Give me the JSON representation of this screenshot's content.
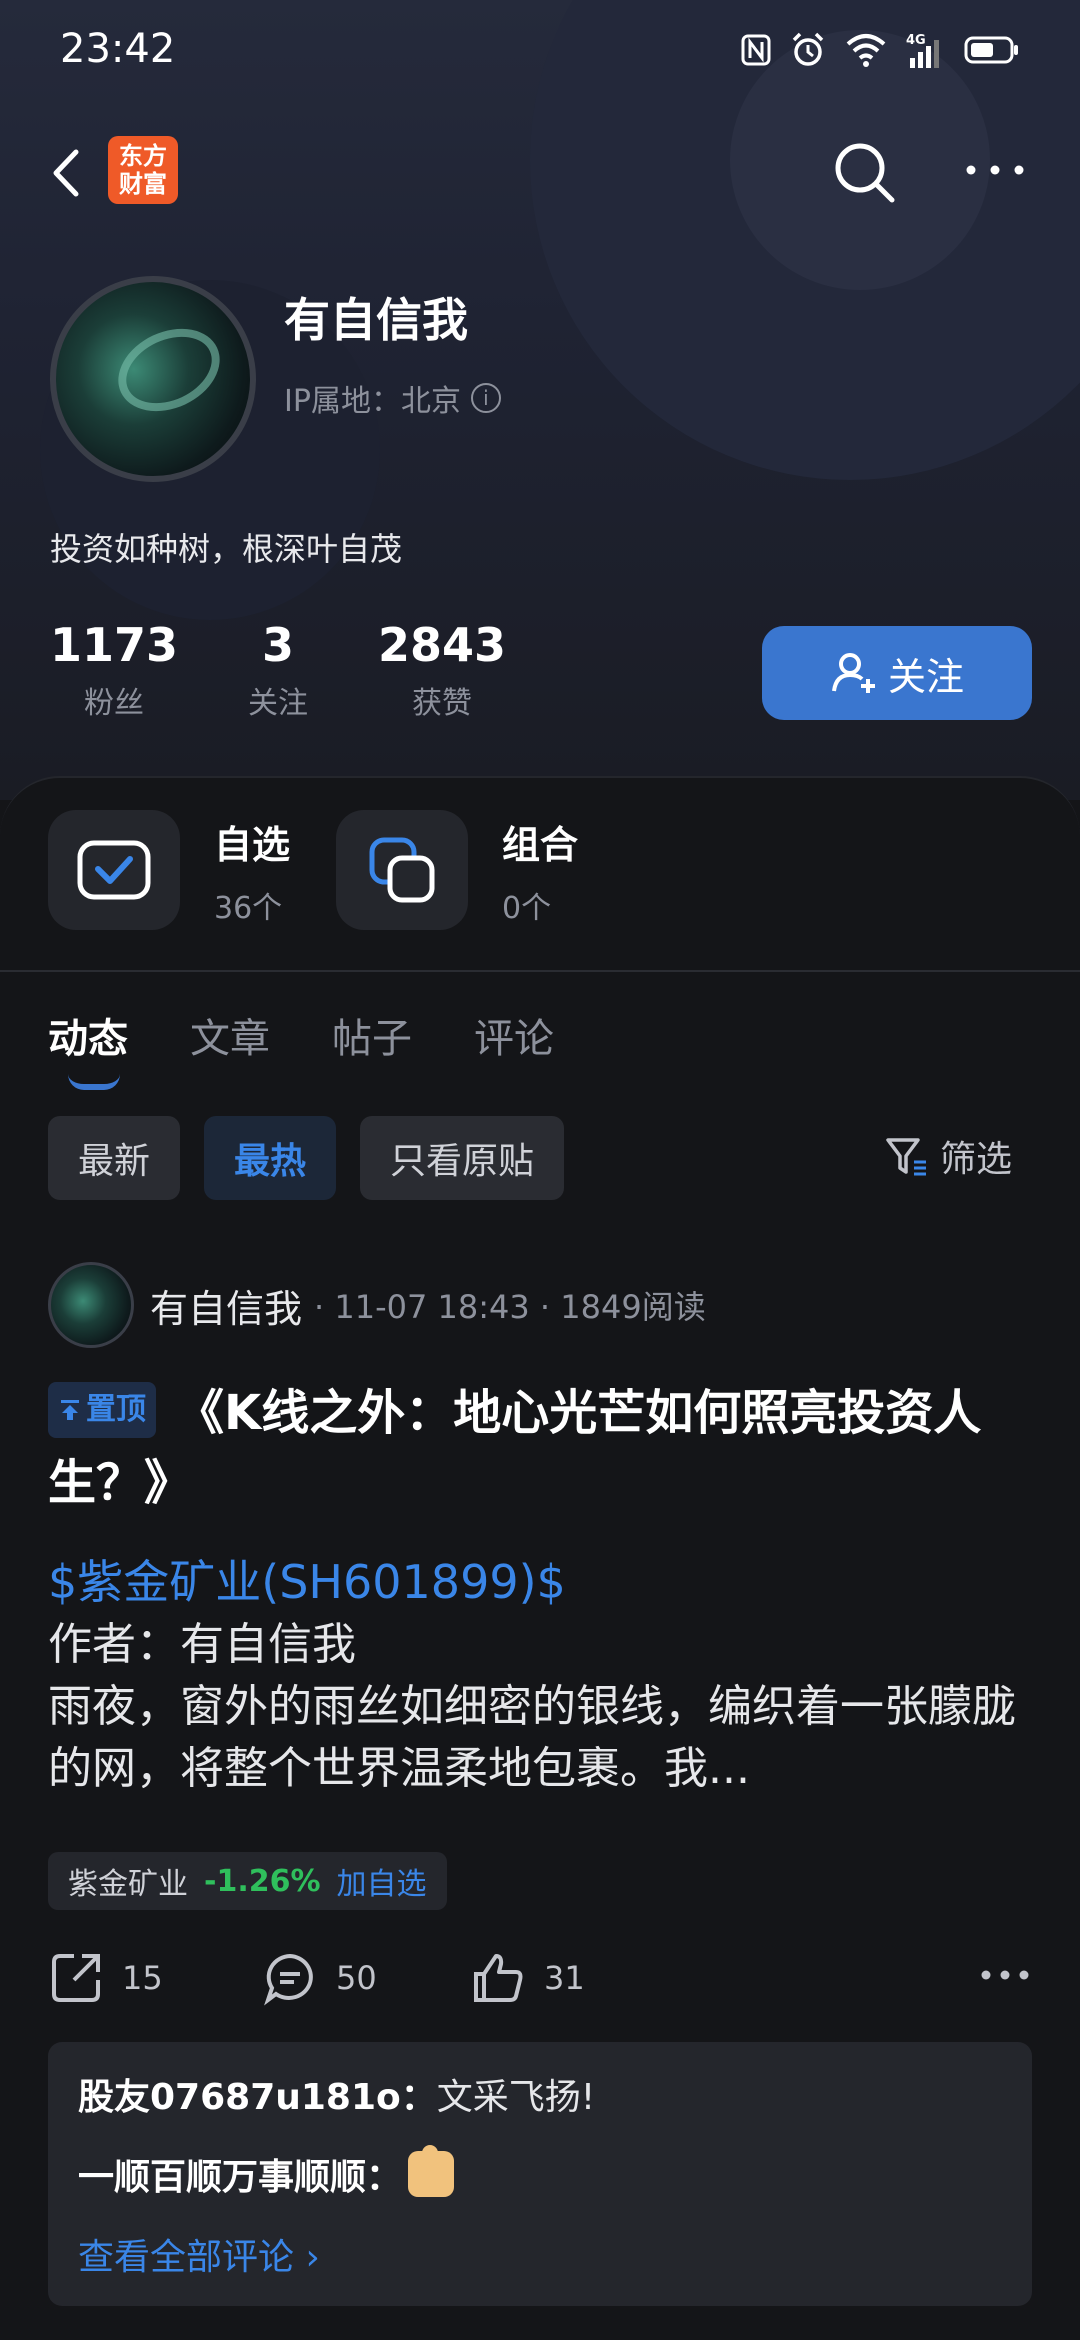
{
  "status_bar": {
    "time": "23:42"
  },
  "header": {
    "logo_text": "东方\n财富"
  },
  "profile": {
    "name": "有自信我",
    "ip_location": "IP属地：北京",
    "bio": "投资如种树，根深叶自茂",
    "stats": [
      {
        "value": "1173",
        "label": "粉丝"
      },
      {
        "value": "3",
        "label": "关注"
      },
      {
        "value": "2843",
        "label": "获赞"
      }
    ],
    "follow_label": "关注"
  },
  "quick_links": [
    {
      "title": "自选",
      "sub": "36个"
    },
    {
      "title": "组合",
      "sub": "0个"
    }
  ],
  "tabs": [
    "动态",
    "文章",
    "帖子",
    "评论"
  ],
  "filters": [
    "最新",
    "最热",
    "只看原贴"
  ],
  "filter_label": "筛选",
  "post": {
    "author": "有自信我",
    "meta": "· 11-07 18:43 · 1849阅读",
    "pin_label": "置顶",
    "title": "《K线之外：地心光芒如何照亮投资人生？》",
    "stock_link": "$紫金矿业(SH601899)$",
    "body_line1": "作者：有自信我",
    "body_line2": "雨夜，窗外的雨丝如细密的银线，编织着一张朦胧的网，将整个世界温柔地包裹。我...",
    "stock_tag": {
      "name": "紫金矿业",
      "change": "-1.26%",
      "add_label": "加自选"
    },
    "shares": "15",
    "comments": "50",
    "likes": "31"
  },
  "comments": [
    {
      "user": "股友07687u181o：",
      "text": "文采飞扬!"
    },
    {
      "user": "一顺百顺万事顺顺：",
      "text": ""
    }
  ],
  "view_all_label": "查看全部评论 ›",
  "colors": {
    "accent": "#3a76cf",
    "link": "#3a86e8",
    "down": "#2fbf5c",
    "bg": "#141518"
  }
}
